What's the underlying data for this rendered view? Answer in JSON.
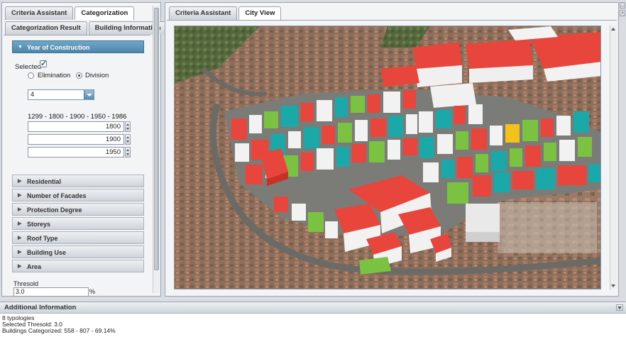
{
  "left_panel": {
    "tabs_row1": [
      "Criteria Assistant",
      "Categorization"
    ],
    "tabs_row2": [
      "Categorization Result",
      "Building Information"
    ],
    "active_tab": "Categorization",
    "year_section": {
      "title": "Year of Construction",
      "selected_label": "Selected",
      "selected_checked": true,
      "option_elimination": "Elimination",
      "option_division": "Division",
      "division_selected": true,
      "typology_count": "4",
      "range_text": "1299 - 1800 - 1900 - 1950 - 1986",
      "breaks": [
        "1800",
        "1900",
        "1950"
      ]
    },
    "sections": [
      "Residential",
      "Number of Facades",
      "Protection Degree",
      "Storeys",
      "Roof Type",
      "Building Use",
      "Area"
    ],
    "threshold": {
      "label": "Thresold",
      "value": "3.0",
      "unit": "%"
    }
  },
  "right_panel": {
    "tabs": [
      "Criteria Assistant",
      "City View"
    ],
    "active_tab": "City View"
  },
  "bottom_panel": {
    "title": "Additional Information",
    "lines": [
      "8 typologies",
      "Selected Thresold: 3.0",
      "Buildings Categorized: 558 - 807 - 69.14%"
    ]
  },
  "colors": {
    "accent_header": "#5b93b8",
    "building_red": "#e8463c",
    "building_white": "#f2f2f2",
    "building_teal": "#1aa8a8",
    "building_green": "#7cc242",
    "building_yellow": "#f2c21a"
  },
  "icons": {
    "collapse": "triangle-down-icon",
    "expand": "triangle-right-icon"
  }
}
